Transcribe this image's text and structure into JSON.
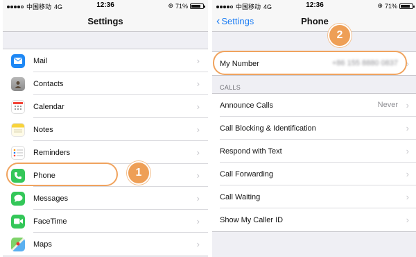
{
  "left": {
    "status": {
      "carrier": "中国移动",
      "network": "4G",
      "time": "12:36",
      "battery": "71%"
    },
    "title": "Settings",
    "items": [
      {
        "label": "Mail",
        "icon": "mail-icon",
        "color": "#1e88f5"
      },
      {
        "label": "Contacts",
        "icon": "contacts-icon",
        "color": "#9a9a9a"
      },
      {
        "label": "Calendar",
        "icon": "calendar-icon",
        "color": "#ffffff"
      },
      {
        "label": "Notes",
        "icon": "notes-icon",
        "color": "#f8d33c"
      },
      {
        "label": "Reminders",
        "icon": "reminders-icon",
        "color": "#ffffff"
      },
      {
        "label": "Phone",
        "icon": "phone-icon",
        "color": "#34c759"
      },
      {
        "label": "Messages",
        "icon": "messages-icon",
        "color": "#34c759"
      },
      {
        "label": "FaceTime",
        "icon": "facetime-icon",
        "color": "#34c759"
      },
      {
        "label": "Maps",
        "icon": "maps-icon",
        "color": "#5ab0f0"
      }
    ],
    "step_badge": "1"
  },
  "right": {
    "status": {
      "carrier": "中国移动",
      "network": "4G",
      "time": "12:36",
      "battery": "71%"
    },
    "back_label": "Settings",
    "title": "Phone",
    "my_number": {
      "label": "My Number",
      "value": "+86 155 8880 0837"
    },
    "section_header": "CALLS",
    "items": [
      {
        "label": "Announce Calls",
        "value": "Never"
      },
      {
        "label": "Call Blocking & Identification",
        "value": ""
      },
      {
        "label": "Respond with Text",
        "value": ""
      },
      {
        "label": "Call Forwarding",
        "value": ""
      },
      {
        "label": "Call Waiting",
        "value": ""
      },
      {
        "label": "Show My Caller ID",
        "value": ""
      }
    ],
    "step_badge": "2"
  },
  "colors": {
    "accent": "#1b7cf4",
    "highlight": "#ee9f56"
  }
}
